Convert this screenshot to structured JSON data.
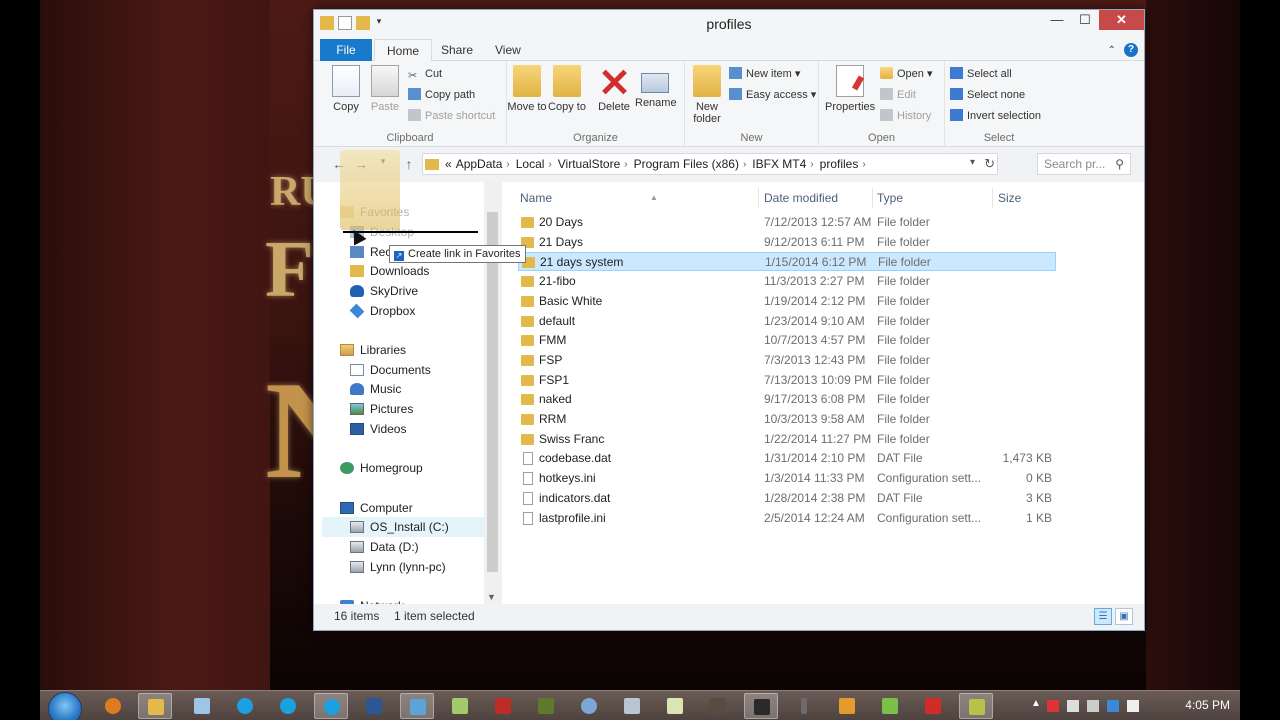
{
  "window": {
    "title": "profiles",
    "minimize": "—",
    "maximize": "☐",
    "close": "✕"
  },
  "tabs": {
    "file": "File",
    "home": "Home",
    "share": "Share",
    "view": "View"
  },
  "ribbon": {
    "clipboard": {
      "label": "Clipboard",
      "copy": "Copy",
      "paste": "Paste",
      "cut": "Cut",
      "copy_path": "Copy path",
      "paste_shortcut": "Paste shortcut"
    },
    "organize": {
      "label": "Organize",
      "move_to": "Move to",
      "copy_to": "Copy to",
      "delete": "Delete",
      "rename": "Rename"
    },
    "new": {
      "label": "New",
      "new_folder": "New folder",
      "new_item": "New item ▾",
      "easy_access": "Easy access ▾"
    },
    "open": {
      "label": "Open",
      "properties": "Properties",
      "open": "Open ▾",
      "edit": "Edit",
      "history": "History"
    },
    "select": {
      "label": "Select",
      "select_all": "Select all",
      "select_none": "Select none",
      "invert_selection": "Invert selection"
    }
  },
  "address": {
    "prefix": "«",
    "crumbs": [
      "AppData",
      "Local",
      "VirtualStore",
      "Program Files (x86)",
      "IBFX MT4",
      "profiles"
    ],
    "search_placeholder": "Search pr..."
  },
  "nav": {
    "favorites": "Favorites",
    "desktop": "Desktop",
    "recent_places": "Recent places",
    "downloads": "Downloads",
    "skydrive": "SkyDrive",
    "dropbox": "Dropbox",
    "libraries": "Libraries",
    "documents": "Documents",
    "music": "Music",
    "pictures": "Pictures",
    "videos": "Videos",
    "homegroup": "Homegroup",
    "computer": "Computer",
    "os_install": "OS_Install (C:)",
    "data_d": "Data (D:)",
    "lynn_pc": "Lynn (lynn-pc)",
    "network": "Network"
  },
  "columns": {
    "name": "Name",
    "date_modified": "Date modified",
    "type": "Type",
    "size": "Size"
  },
  "files": [
    {
      "name": "20 Days",
      "date": "7/12/2013 12:57 AM",
      "type": "File folder",
      "size": "",
      "kind": "folder"
    },
    {
      "name": "21 Days",
      "date": "9/12/2013 6:11 PM",
      "type": "File folder",
      "size": "",
      "kind": "folder"
    },
    {
      "name": "21 days system",
      "date": "1/15/2014 6:12 PM",
      "type": "File folder",
      "size": "",
      "kind": "folder",
      "selected": true
    },
    {
      "name": "21-fibo",
      "date": "11/3/2013 2:27 PM",
      "type": "File folder",
      "size": "",
      "kind": "folder"
    },
    {
      "name": "Basic White",
      "date": "1/19/2014 2:12 PM",
      "type": "File folder",
      "size": "",
      "kind": "folder"
    },
    {
      "name": "default",
      "date": "1/23/2014 9:10 AM",
      "type": "File folder",
      "size": "",
      "kind": "folder"
    },
    {
      "name": "FMM",
      "date": "10/7/2013 4:57 PM",
      "type": "File folder",
      "size": "",
      "kind": "folder"
    },
    {
      "name": "FSP",
      "date": "7/3/2013 12:43 PM",
      "type": "File folder",
      "size": "",
      "kind": "folder"
    },
    {
      "name": "FSP1",
      "date": "7/13/2013 10:09 PM",
      "type": "File folder",
      "size": "",
      "kind": "folder"
    },
    {
      "name": "naked",
      "date": "9/17/2013 6:08 PM",
      "type": "File folder",
      "size": "",
      "kind": "folder"
    },
    {
      "name": "RRM",
      "date": "10/3/2013 9:58 AM",
      "type": "File folder",
      "size": "",
      "kind": "folder"
    },
    {
      "name": "Swiss Franc",
      "date": "1/22/2014 11:27 PM",
      "type": "File folder",
      "size": "",
      "kind": "folder"
    },
    {
      "name": "codebase.dat",
      "date": "1/31/2014 2:10 PM",
      "type": "DAT File",
      "size": "1,473 KB",
      "kind": "dat"
    },
    {
      "name": "hotkeys.ini",
      "date": "1/3/2014 11:33 PM",
      "type": "Configuration sett...",
      "size": "0 KB",
      "kind": "ini"
    },
    {
      "name": "indicators.dat",
      "date": "1/28/2014 2:38 PM",
      "type": "DAT File",
      "size": "3 KB",
      "kind": "dat"
    },
    {
      "name": "lastprofile.ini",
      "date": "2/5/2014 12:24 AM",
      "type": "Configuration sett...",
      "size": "1 KB",
      "kind": "ini"
    }
  ],
  "status": {
    "item_count": "16 items",
    "selection": "1 item selected"
  },
  "drag": {
    "tooltip": "Create link in Favorites"
  },
  "taskbar": {
    "clock": "4:05 PM"
  },
  "background": {
    "ru": "RU",
    "f": "F",
    "n": "N"
  }
}
